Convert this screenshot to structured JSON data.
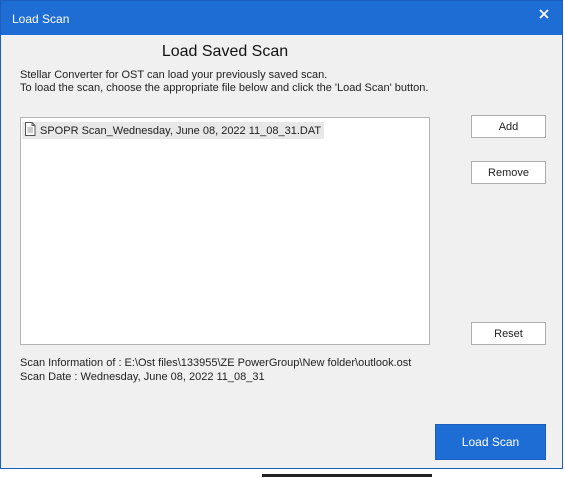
{
  "dialog": {
    "title": "Load Scan",
    "close_icon": "close-icon",
    "heading": "Load Saved Scan",
    "description_line1": "Stellar Converter for OST can load your previously saved scan.",
    "description_line2": "To load the scan, choose the appropriate file below and click the 'Load Scan' button."
  },
  "file_list": {
    "items": [
      {
        "icon": "document-icon",
        "label": "SPOPR Scan_Wednesday, June 08, 2022 11_08_31.DAT"
      }
    ]
  },
  "buttons": {
    "add": "Add",
    "remove": "Remove",
    "reset": "Reset",
    "load_scan": "Load Scan"
  },
  "scan_info": {
    "information": "Scan Information of : E:\\Ost files\\133955\\ZE PowerGroup\\New folder\\outlook.ost",
    "date": "Scan Date : Wednesday, June 08, 2022 11_08_31"
  },
  "colors": {
    "accent": "#1e6dd4",
    "dialog_background": "#f0f0f0"
  }
}
